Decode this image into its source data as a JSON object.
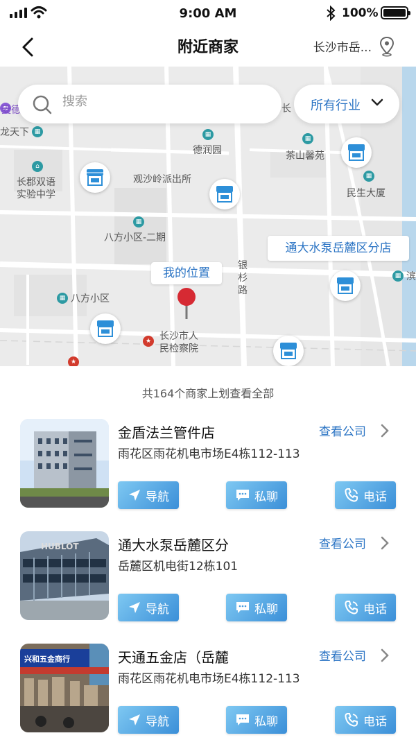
{
  "status_bar": {
    "time": "9:00 AM",
    "battery": "100%"
  },
  "nav": {
    "title": "附近商家",
    "city": "长沙市岳..."
  },
  "search": {
    "placeholder": "搜索"
  },
  "filter": {
    "industry_label": "所有行业"
  },
  "map": {
    "my_location_label": "我的位置",
    "highlight_label": "通大水泵岳麓区分店",
    "pois": {
      "maiguo": "麦德",
      "longtianxia": "龙天下",
      "changjun": "长郡双语\n实验中学",
      "derunyuan": "德润园",
      "guanshaling": "观沙岭派出所",
      "chashan": "茶山馨苑",
      "minsheng": "民生大厦",
      "bafang2": "八方小区-二期",
      "bafang": "八方小区",
      "jianchayuan": "长沙市人\n民检察院",
      "changjian": "长",
      "bin": "滨",
      "road": "银杉路"
    }
  },
  "list": {
    "total_text": "共164个商家上划查看全部",
    "view_company_label": "查看公司",
    "nav_label": "导航",
    "chat_label": "私聊",
    "call_label": "电话",
    "merchants": [
      {
        "name": "金盾法兰管件店",
        "address": "雨花区雨花机电市场E4栋112-113"
      },
      {
        "name": "通大水泵岳麓区分",
        "address": "岳麓区机电街12栋101"
      },
      {
        "name": "天通五金店（岳麓",
        "address": "雨花区雨花机电市场E4栋112-113"
      }
    ]
  },
  "colors": {
    "accent": "#2b74c4",
    "button_start": "#7ec8f2",
    "button_end": "#3b8fd8",
    "pin": "#d62a33"
  }
}
